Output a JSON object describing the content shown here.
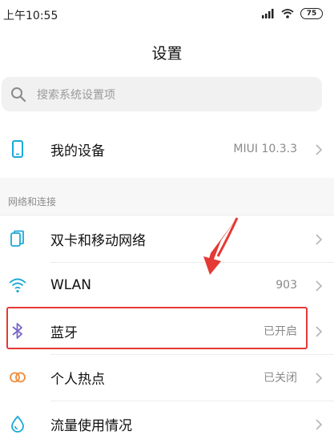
{
  "status_bar": {
    "time": "上午10:55",
    "battery": "75"
  },
  "header": {
    "title": "设置"
  },
  "search": {
    "placeholder": "搜索系统设置项"
  },
  "my_device": {
    "label": "我的设备",
    "value": "MIUI 10.3.3"
  },
  "section": {
    "header": "网络和连接"
  },
  "network_items": [
    {
      "label": "双卡和移动网络",
      "value": "",
      "icon": "sim-card-icon"
    },
    {
      "label": "WLAN",
      "value": "903",
      "icon": "wifi-icon"
    },
    {
      "label": "蓝牙",
      "value": "已开启",
      "icon": "bluetooth-icon"
    },
    {
      "label": "个人热点",
      "value": "已关闭",
      "icon": "hotspot-icon"
    },
    {
      "label": "流量使用情况",
      "value": "",
      "icon": "data-usage-icon"
    }
  ],
  "colors": {
    "accent": "#1ba9d6",
    "highlight": "#e53935",
    "bluetooth": "#7a64c8",
    "hotspot": "#ef8b3a"
  }
}
